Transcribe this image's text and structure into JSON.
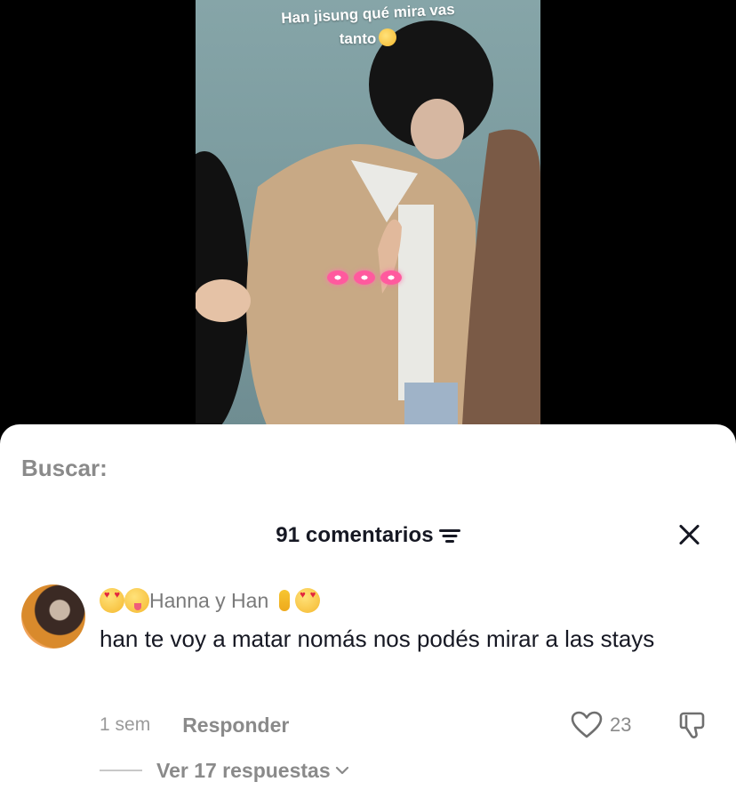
{
  "video": {
    "caption_line1": "Han jisung qué mira vas",
    "caption_line2": "tanto"
  },
  "sheet": {
    "search_label": "Buscar:",
    "comments_title": "91 comentarios"
  },
  "comment": {
    "username": "Hanna y Han",
    "text": "han te voy a matar nomás nos podés mirar a las stays",
    "time": "1 sem",
    "reply_label": "Responder",
    "like_count": "23",
    "view_replies": "Ver 17 respuestas"
  },
  "colors": {
    "text_primary": "#161823",
    "text_secondary": "#8a8a8a",
    "sheet_bg": "#ffffff",
    "backdrop": "#000000"
  },
  "icons": [
    "filter-icon",
    "close-icon",
    "heart-icon",
    "dislike-icon",
    "chevron-down-icon"
  ]
}
